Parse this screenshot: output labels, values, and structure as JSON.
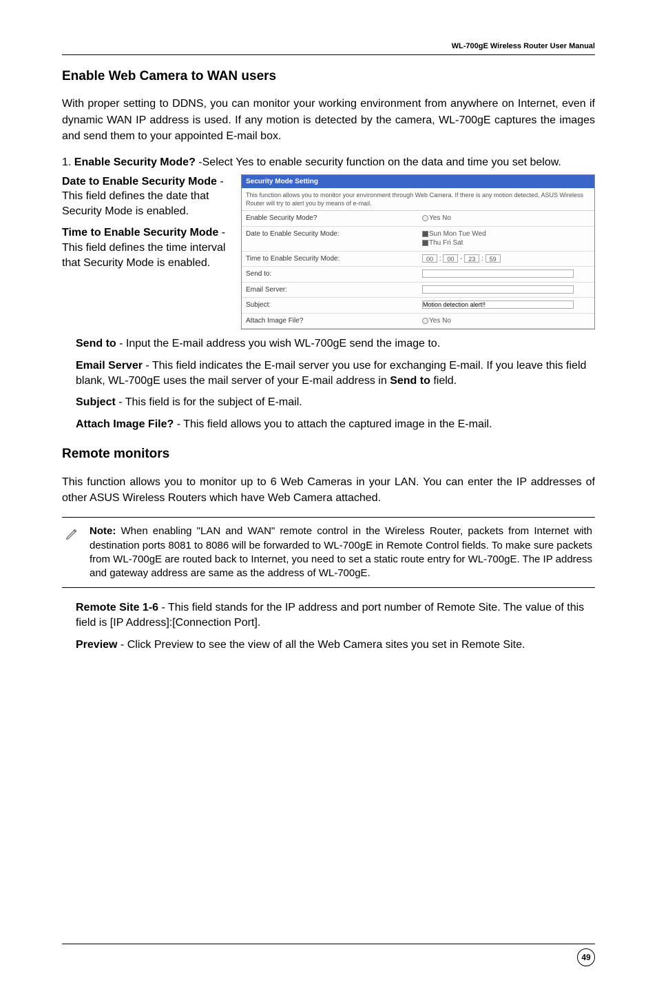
{
  "header": {
    "manual_title": "WL-700gE Wireless Router User Manual"
  },
  "section1": {
    "title": "Enable Web Camera to WAN users",
    "intro": "With proper setting to DDNS, you can monitor your working environment from anywhere on Internet, even if dynamic WAN IP address is used. If any motion is detected by the camera, WL-700gE captures the images and send them to your appointed E-mail box.",
    "step1_prefix": "1. ",
    "step1_label": "Enable Security Mode?",
    "step1_rest": " -Select Yes to enable security function on the data and time you set below.",
    "date_label": "Date to Enable Security Mode",
    "date_dash": " - ",
    "date_text": "This field defines the date that Security Mode is enabled.",
    "time_label": "Time to Enable Security Mode",
    "time_dash": " - ",
    "time_prefix": "This field defines the time interval that Security Mode is enabled.",
    "sendto_label": "Send to",
    "sendto_text": " - Input the E-mail address you wish WL-700gE send the image to.",
    "emailserver_label": "Email Server",
    "emailserver_text": " - This field indicates the E-mail server you use for exchanging E-mail. If you leave this field blank, WL-700gE uses the mail server of your E-mail address in ",
    "emailserver_sendto": "Send to",
    "emailserver_field": " field.",
    "subject_label": "Subject",
    "subject_text": " - This field is for the subject of E-mail.",
    "attach_label": "Attach Image File?",
    "attach_text": " - This field allows you to attach the captured image in the E-mail."
  },
  "screenshot": {
    "header": "Security Mode Setting",
    "desc": "This function allows you to monitor your environment through Web Camera. If there is any motion detected, ASUS Wireless Router will try to alert you by means of e-mail.",
    "rows": {
      "enable_label": "Enable Security Mode?",
      "enable_ctl": "Yes   No",
      "date_label": "Date to Enable Security Mode:",
      "date_ctl_line1": "Sun  Mon  Tue  Wed",
      "date_ctl_line2": "Thu  Fri  Sat",
      "time_label": "Time to Enable Security Mode:",
      "time_v1": "00",
      "time_v2": "00",
      "time_v3": "23",
      "time_v4": "59",
      "sendto_label": "Send to:",
      "emailserver_label": "Email Server:",
      "subject_label": "Subject:",
      "subject_value": "Motion detection alert!!",
      "attach_label": "Attach Image File?",
      "attach_ctl": "Yes   No"
    }
  },
  "section2": {
    "title": "Remote monitors",
    "intro": "This function allows you to monitor up to 6 Web Cameras in your LAN. You can enter the IP addresses of other ASUS Wireless Routers which have Web Camera attached.",
    "note_label": "Note:",
    "note_text": " When enabling \"LAN and WAN\" remote control in the Wireless Router, packets from Internet with destination ports 8081 to 8086 will be forwarded to WL-700gE in Remote Control fields. To make sure packets from WL-700gE are routed back to Internet, you need to set a static route entry for WL-700gE. The IP address and gateway address are same as the address of WL-700gE.",
    "remote_label": "Remote Site 1-6",
    "remote_text": " - This field stands for the IP address and port number of Remote Site. The value of this field is [IP Address]:[Connection Port].",
    "preview_label": "Preview",
    "preview_text": " - Click Preview to see the view of all the Web Camera sites you set in Remote Site."
  },
  "footer": {
    "page": "49"
  }
}
